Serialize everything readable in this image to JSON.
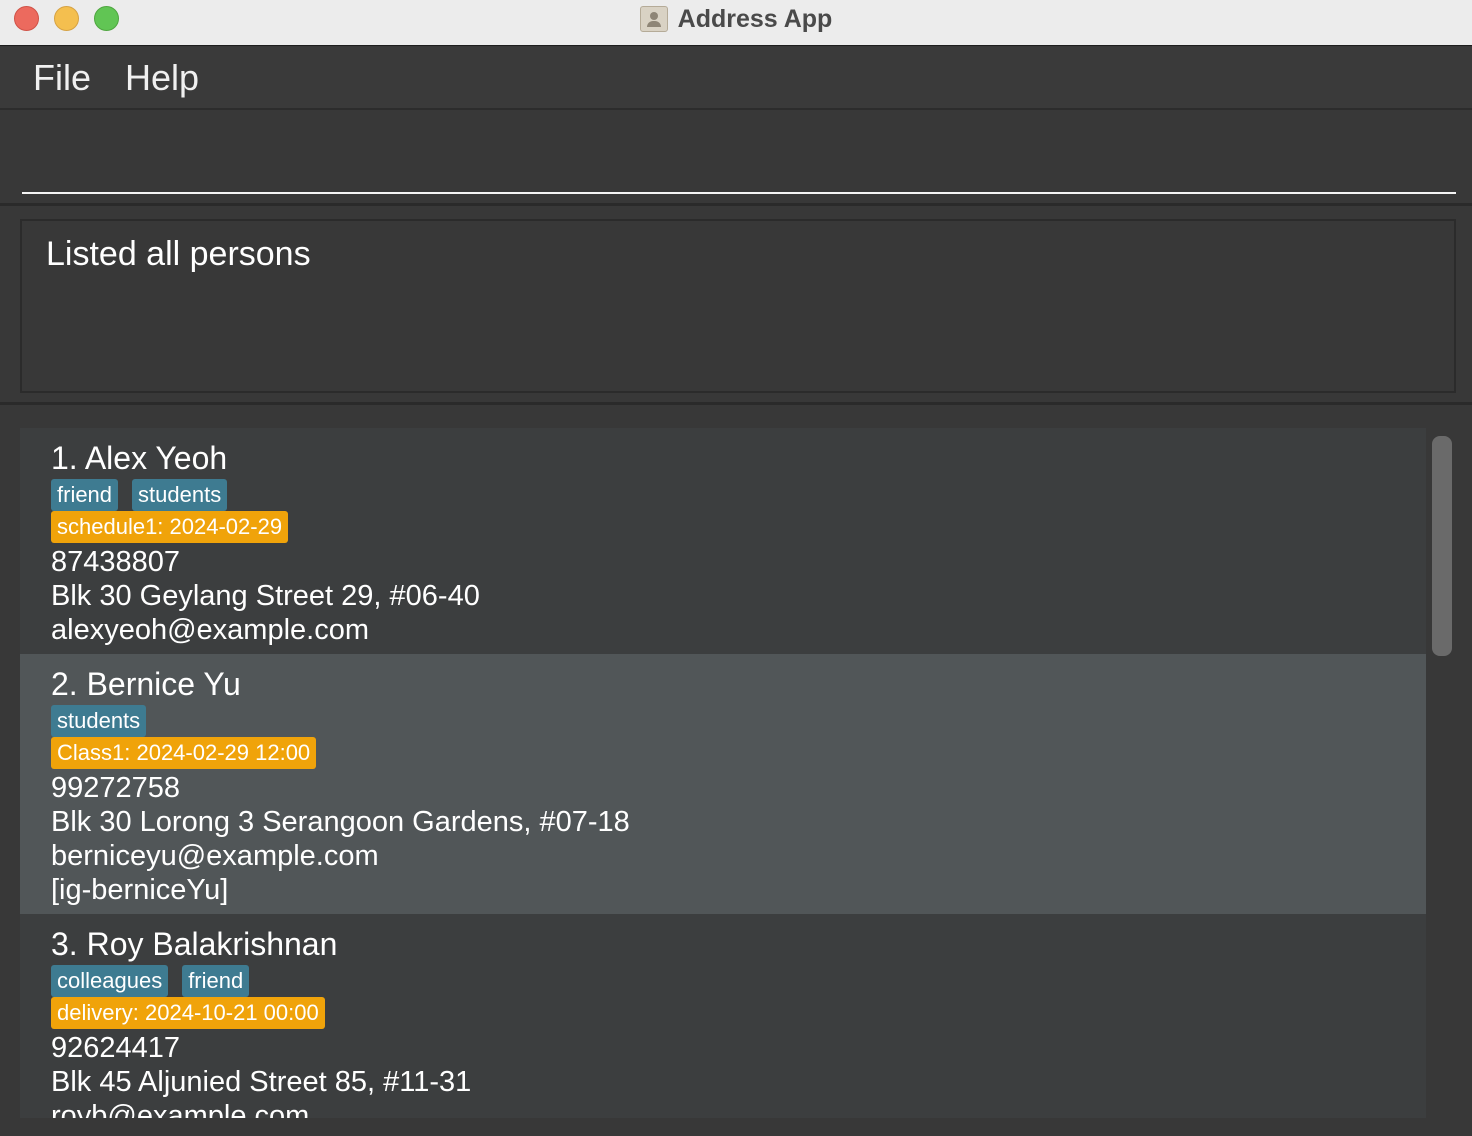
{
  "window": {
    "title": "Address App"
  },
  "menu": {
    "file": "File",
    "help": "Help"
  },
  "command": {
    "value": ""
  },
  "result": {
    "message": "Listed all persons"
  },
  "persons": [
    {
      "name": "1. Alex Yeoh",
      "tags": [
        "friend",
        "students"
      ],
      "schedule": "schedule1: 2024-02-29",
      "phone": "87438807",
      "address": "Blk 30 Geylang Street 29, #06-40",
      "email": "alexyeoh@example.com",
      "social": ""
    },
    {
      "name": "2. Bernice Yu",
      "tags": [
        "students"
      ],
      "schedule": "Class1: 2024-02-29 12:00",
      "phone": "99272758",
      "address": "Blk 30 Lorong 3 Serangoon Gardens, #07-18",
      "email": "berniceyu@example.com",
      "social": "[ig-berniceYu]"
    },
    {
      "name": "3. Roy Balakrishnan",
      "tags": [
        "colleagues",
        "friend"
      ],
      "schedule": "delivery: 2024-10-21 00:00",
      "phone": "92624417",
      "address": "Blk 45 Aljunied Street 85, #11-31",
      "email": "royb@example.com",
      "social": ""
    }
  ],
  "colors": {
    "tag": "#3e7b91",
    "schedule": "#f0a30a",
    "selected_row": "#515658",
    "background": "#383838"
  }
}
